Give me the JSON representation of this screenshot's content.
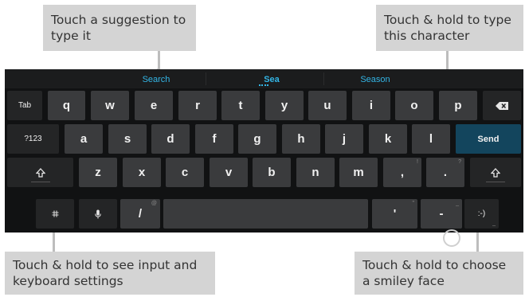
{
  "callouts": {
    "suggestion": "Touch a suggestion to type it",
    "hold_character": "Touch & hold to type this character",
    "settings": "Touch & hold to see input and keyboard settings",
    "smiley": "Touch & hold to choose a smiley face"
  },
  "suggestions": [
    "Search",
    "Sea",
    "Season"
  ],
  "keys": {
    "row1": {
      "tab": "Tab",
      "letters": [
        "q",
        "w",
        "e",
        "r",
        "t",
        "y",
        "u",
        "i",
        "o",
        "p"
      ],
      "backspace": "backspace-icon"
    },
    "row2": {
      "symbols": "?123",
      "letters": [
        "a",
        "s",
        "d",
        "f",
        "g",
        "h",
        "j",
        "k",
        "l"
      ],
      "send": "Send"
    },
    "row3": {
      "shift": "shift-icon",
      "letters": [
        "z",
        "x",
        "c",
        "v",
        "b",
        "n",
        "m"
      ],
      "comma": ",",
      "comma_hint": "!",
      "period": ".",
      "period_hint": "?"
    },
    "row4": {
      "settings": "settings-icon",
      "mic": "microphone-icon",
      "slash": "/",
      "slash_hint": "@",
      "apostrophe": "'",
      "apostrophe_hint": "\"",
      "dash": "-",
      "dash_hint": "_",
      "smiley": ":-)"
    }
  },
  "colors": {
    "accent": "#33b5e5",
    "send": "#13455d",
    "key": "#3a3b3d",
    "background": "#111213"
  }
}
